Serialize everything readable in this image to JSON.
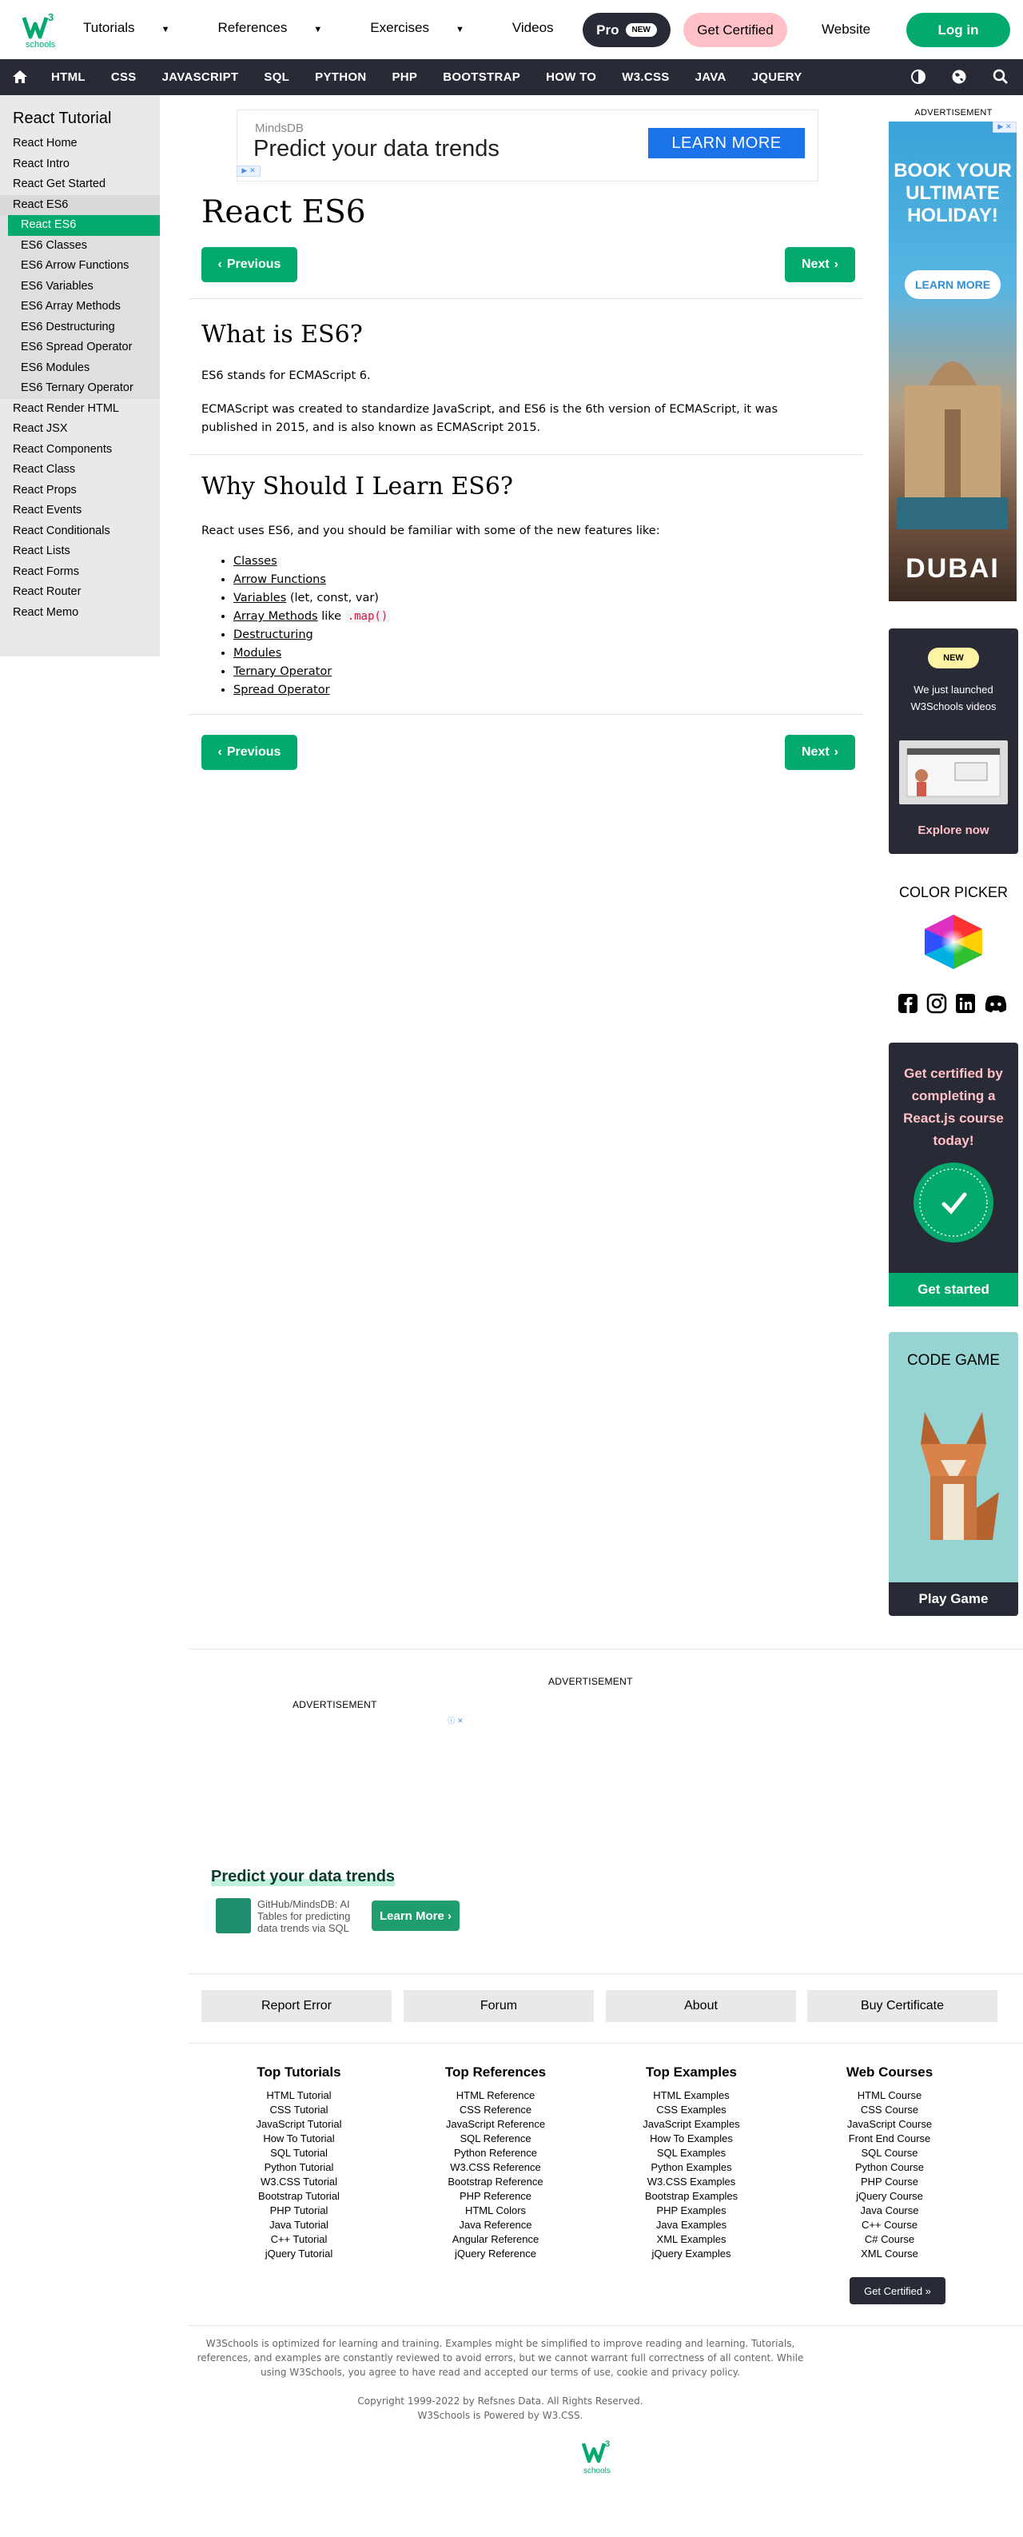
{
  "topnav": {
    "items": [
      "Tutorials",
      "References",
      "Exercises",
      "Videos"
    ],
    "pro_label": "Pro",
    "new_badge": "NEW",
    "get_certified": "Get Certified",
    "website": "Website",
    "login": "Log in"
  },
  "darknav": {
    "items": [
      "HTML",
      "CSS",
      "JAVASCRIPT",
      "SQL",
      "PYTHON",
      "PHP",
      "BOOTSTRAP",
      "HOW TO",
      "W3.CSS",
      "JAVA",
      "JQUERY"
    ]
  },
  "sidebar": {
    "title": "React Tutorial",
    "items": [
      "React Home",
      "React Intro",
      "React Get Started",
      "React ES6",
      "React ES6",
      "ES6 Classes",
      "ES6 Arrow Functions",
      "ES6 Variables",
      "ES6 Array Methods",
      "ES6 Destructuring",
      "ES6 Spread Operator",
      "ES6 Modules",
      "ES6 Ternary Operator",
      "React Render HTML",
      "React JSX",
      "React Components",
      "React Class",
      "React Props",
      "React Events",
      "React Conditionals",
      "React Lists",
      "React Forms",
      "React Router",
      "React Memo"
    ]
  },
  "ad_top": {
    "brand": "MindsDB",
    "headline": "Predict your data trends",
    "cta": "LEARN MORE"
  },
  "content": {
    "title": "React ES6",
    "prev": "Previous",
    "next": "Next",
    "h_what": "What is ES6?",
    "p1": "ES6 stands for ECMAScript 6.",
    "p2": "ECMAScript was created to standardize JavaScript, and ES6 is the 6th version of ECMAScript, it was published in 2015, and is also known as ECMAScript 2015.",
    "h_why": "Why Should I Learn ES6?",
    "p3": "React uses ES6, and you should be familiar with some of the new features like:",
    "features": {
      "classes": "Classes",
      "arrow": "Arrow Functions",
      "variables": "Variables",
      "variables_note": "(let, const, var)",
      "array_methods": "Array Methods",
      "array_like": "like",
      "array_code": ".map()",
      "destructuring": "Destructuring",
      "modules": "Modules",
      "ternary": "Ternary Operator",
      "spread": "Spread Operator"
    }
  },
  "rail": {
    "advertisement": "ADVERTISEMENT",
    "dubai_text": "BOOK YOUR ULTIMATE HOLIDAY!",
    "dubai_cta": "LEARN MORE",
    "dubai_logo": "DUBAI",
    "video_new": "NEW",
    "video_text": "We just launched W3Schools videos",
    "video_cta": "Explore now",
    "color_picker": "COLOR PICKER",
    "cert_text": "Get certified by completing a React.js course today!",
    "cert_cta": "Get started",
    "game_title": "CODE GAME",
    "game_cta": "Play Game"
  },
  "bottom_ad": {
    "label": "ADVERTISEMENT",
    "label2": "ADVERTISEMENT",
    "headline": "Predict your data trends",
    "sub": "GitHub/MindsDB: AI Tables for predicting data trends via SQL",
    "cta": "Learn More"
  },
  "footer": {
    "buttons": [
      "Report Error",
      "Forum",
      "About",
      "Buy Certificate"
    ],
    "cols": [
      {
        "title": "Top Tutorials",
        "items": [
          "HTML Tutorial",
          "CSS Tutorial",
          "JavaScript Tutorial",
          "How To Tutorial",
          "SQL Tutorial",
          "Python Tutorial",
          "W3.CSS Tutorial",
          "Bootstrap Tutorial",
          "PHP Tutorial",
          "Java Tutorial",
          "C++ Tutorial",
          "jQuery Tutorial"
        ]
      },
      {
        "title": "Top References",
        "items": [
          "HTML Reference",
          "CSS Reference",
          "JavaScript Reference",
          "SQL Reference",
          "Python Reference",
          "W3.CSS Reference",
          "Bootstrap Reference",
          "PHP Reference",
          "HTML Colors",
          "Java Reference",
          "Angular Reference",
          "jQuery Reference"
        ]
      },
      {
        "title": "Top Examples",
        "items": [
          "HTML Examples",
          "CSS Examples",
          "JavaScript Examples",
          "How To Examples",
          "SQL Examples",
          "Python Examples",
          "W3.CSS Examples",
          "Bootstrap Examples",
          "PHP Examples",
          "Java Examples",
          "XML Examples",
          "jQuery Examples"
        ]
      },
      {
        "title": "Web Courses",
        "items": [
          "HTML Course",
          "CSS Course",
          "JavaScript Course",
          "Front End Course",
          "SQL Course",
          "Python Course",
          "PHP Course",
          "jQuery Course",
          "Java Course",
          "C++ Course",
          "C# Course",
          "XML Course"
        ]
      }
    ],
    "get_certified": "Get Certified »",
    "disclaimer": "W3Schools is optimized for learning and training. Examples might be simplified to improve reading and learning. Tutorials, references, and examples are constantly reviewed to avoid errors, but we cannot warrant full correctness of all content. While using W3Schools, you agree to have read and accepted our terms of use, cookie and privacy policy.",
    "copyright": "Copyright 1999-2022 by Refsnes Data. All Rights Reserved.",
    "powered": "W3Schools is Powered by W3.CSS."
  },
  "colors": {
    "green": "#04AA6D",
    "dark": "#282A35",
    "pink": "#FFC0C7"
  }
}
